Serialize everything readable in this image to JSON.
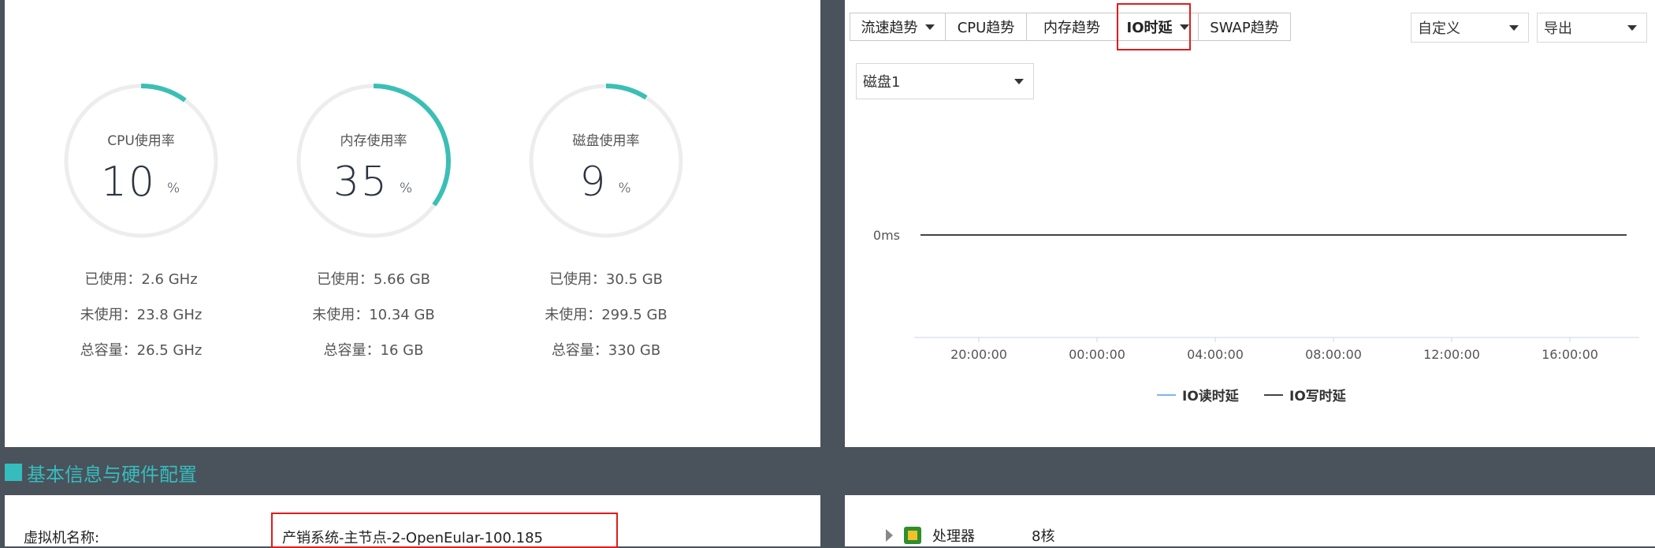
{
  "gauges": [
    {
      "label": "CPU使用率",
      "value": "10",
      "unit": "%",
      "percent": 10,
      "used": "已使用：2.6 GHz",
      "unused": "未使用：23.8 GHz",
      "total": "总容量：26.5 GHz"
    },
    {
      "label": "内存使用率",
      "value": "35",
      "unit": "%",
      "percent": 35,
      "used": "已使用：5.66 GB",
      "unused": "未使用：10.34 GB",
      "total": "总容量：16 GB"
    },
    {
      "label": "磁盘使用率",
      "value": "9",
      "unit": "%",
      "percent": 9,
      "used": "已使用：30.5 GB",
      "unused": "未使用：299.5 GB",
      "total": "总容量：330 GB"
    }
  ],
  "colors": {
    "accent": "#3bbfb5",
    "track": "#ededed",
    "highlight": "#e01b1b",
    "section": "#35bdbd"
  },
  "tabs": [
    {
      "label": "流速趋势",
      "dropdown": true,
      "active": false
    },
    {
      "label": "CPU趋势",
      "dropdown": false,
      "active": false
    },
    {
      "label": "内存趋势",
      "dropdown": false,
      "active": false
    },
    {
      "label": "IO时延",
      "dropdown": true,
      "active": true
    },
    {
      "label": "SWAP趋势",
      "dropdown": false,
      "active": false
    }
  ],
  "range_select": "自定义",
  "export_select": "导出",
  "disk_select": "磁盘1",
  "chart_data": {
    "type": "line",
    "x": [
      "20:00:00",
      "00:00:00",
      "04:00:00",
      "08:00:00",
      "12:00:00",
      "16:00:00"
    ],
    "y_ticks": [
      "0ms"
    ],
    "series": [
      {
        "name": "IO读时延",
        "color": "#7cb5ec",
        "values": [
          0,
          0,
          0,
          0,
          0,
          0
        ]
      },
      {
        "name": "IO写时延",
        "color": "#434348",
        "values": [
          0,
          0,
          0,
          0,
          0,
          0
        ]
      }
    ],
    "legend": "bottom-center"
  },
  "section_title": "基本信息与硬件配置",
  "vm_name_label": "虚拟机名称:",
  "vm_name_value": "产销系统-主节点-2-OpenEular-100.185",
  "hardware": {
    "name": "处理器",
    "value": "8核",
    "icon": "processor-chip-icon"
  }
}
